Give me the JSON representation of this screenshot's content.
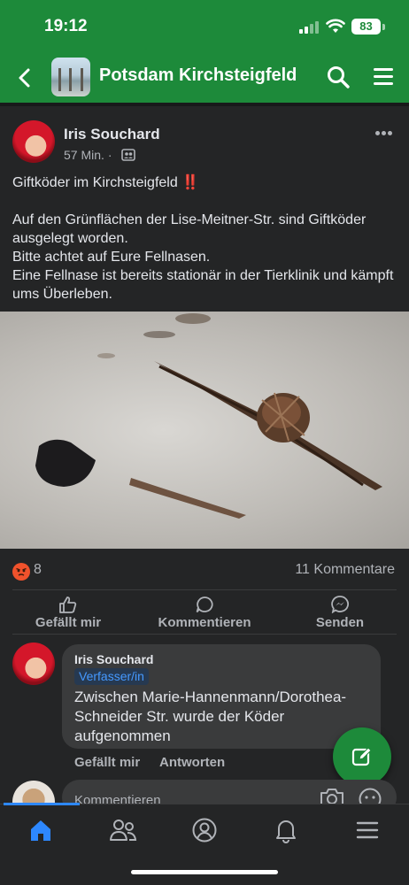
{
  "status_bar": {
    "time": "19:12",
    "battery": "83"
  },
  "header": {
    "title": "Potsdam Kirchsteigfeld"
  },
  "post": {
    "author": "Iris Souchard",
    "time_ago": "57 Min.",
    "meta_sep": "·",
    "title_line": "Giftköder im Kirchsteigfeld",
    "title_emoji": "‼️",
    "line1": "Auf den Grünflächen der Lise-Meitner-Str. sind Giftköder ausgelegt worden.",
    "line2": "Bitte achtet auf Eure Fellnasen.",
    "line3": "Eine Fellnase ist bereits stationär in der Tierklinik und kämpft ums Überleben.",
    "reaction_count": "8",
    "comments_count": "11 Kommentare"
  },
  "actions": {
    "like": "Gefällt mir",
    "comment": "Kommentieren",
    "send": "Senden"
  },
  "comment": {
    "author": "Iris Souchard",
    "badge": "Verfasser/in",
    "text": "Zwischen Marie-Hannenmann/Dorothea-Schneider Str. wurde der Köder aufgenommen",
    "like": "Gefällt mir",
    "reply": "Antworten"
  },
  "composer": {
    "placeholder": "Kommentieren"
  },
  "colors": {
    "brand_green": "#1d8a3a",
    "accent_blue": "#2d88ff",
    "bg": "#242526"
  },
  "icons": [
    "back-arrow-icon",
    "search-icon",
    "hamburger-menu-icon",
    "more-icon",
    "group-privacy-icon",
    "angry-reaction-icon",
    "thumbs-up-icon",
    "comment-icon",
    "messenger-icon",
    "edit-icon",
    "camera-icon",
    "emoji-icon",
    "home-icon",
    "friends-icon",
    "profile-icon",
    "bell-icon",
    "menu-icon"
  ]
}
